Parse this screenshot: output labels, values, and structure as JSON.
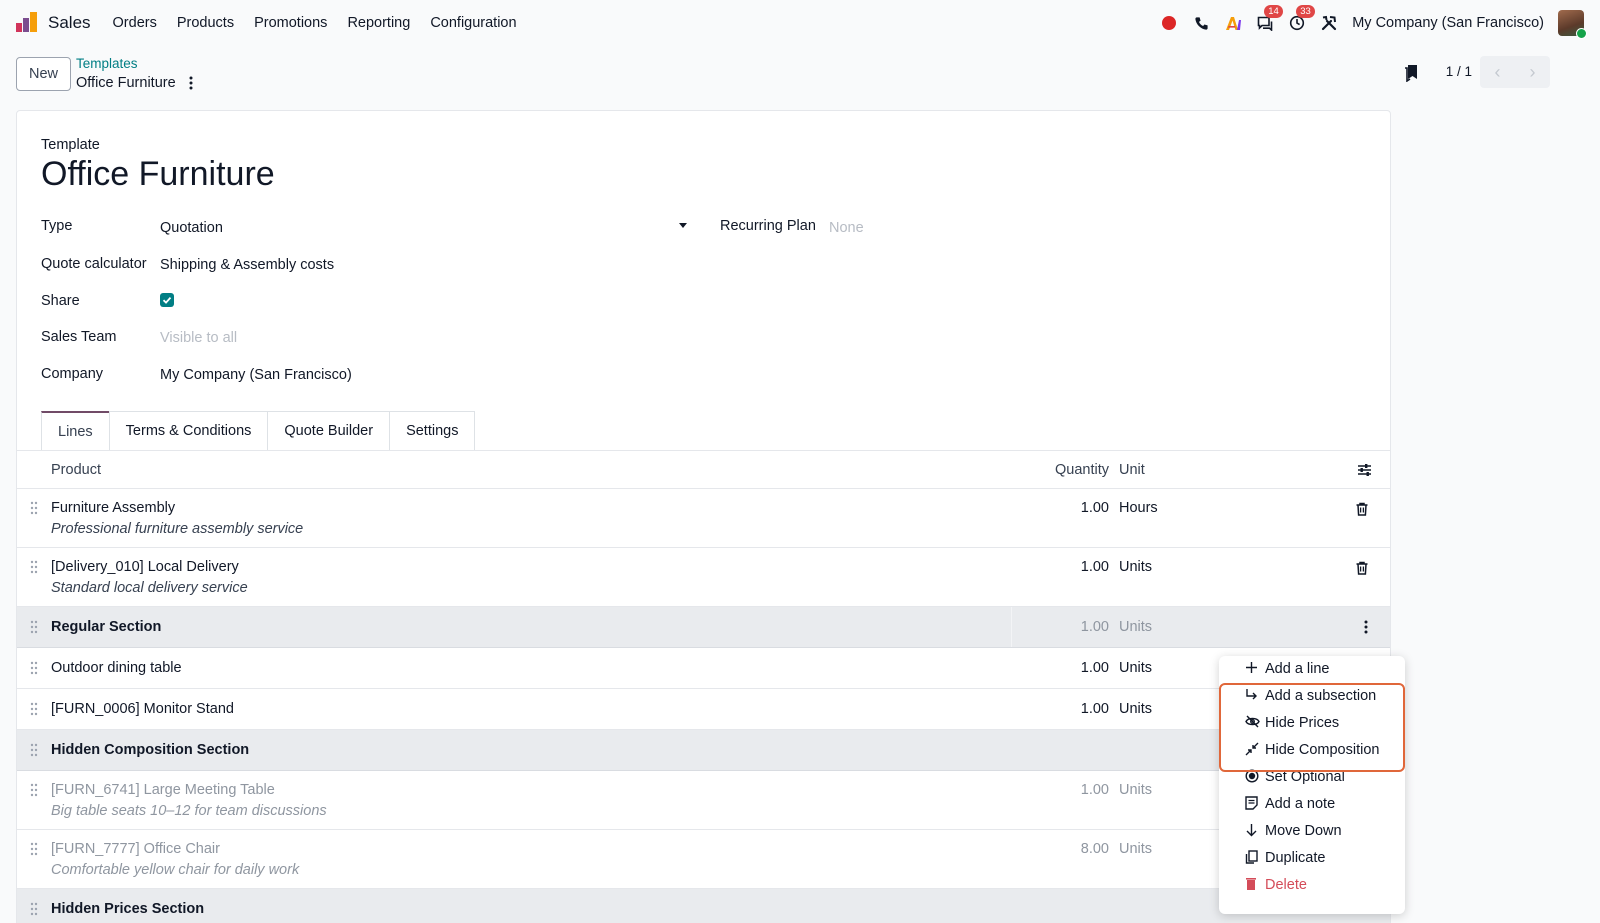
{
  "navbar": {
    "app_name": "Sales",
    "menu": [
      "Orders",
      "Products",
      "Promotions",
      "Reporting",
      "Configuration"
    ],
    "messages_badge": "14",
    "activities_badge": "33",
    "company": "My Company (San Francisco)"
  },
  "control": {
    "new_label": "New",
    "breadcrumb_parent": "Templates",
    "breadcrumb_current": "Office Furniture",
    "pager": "1 / 1"
  },
  "form": {
    "label_template": "Template",
    "title": "Office Furniture",
    "type_label": "Type",
    "type_value": "Quotation",
    "recurring_label": "Recurring Plan",
    "recurring_placeholder": "None",
    "quote_calc_label": "Quote calculator",
    "quote_calc_value": "Shipping & Assembly costs",
    "share_label": "Share",
    "share_checked": true,
    "sales_team_label": "Sales Team",
    "sales_team_placeholder": "Visible to all",
    "company_label": "Company",
    "company_value": "My Company (San Francisco)"
  },
  "tabs": [
    "Lines",
    "Terms & Conditions",
    "Quote Builder",
    "Settings"
  ],
  "list": {
    "headers": {
      "product": "Product",
      "quantity": "Quantity",
      "unit": "Unit"
    },
    "rows": [
      {
        "kind": "line",
        "name": "Furniture Assembly",
        "desc": "Professional furniture assembly service",
        "qty": "1.00",
        "unit": "Hours"
      },
      {
        "kind": "line",
        "name": "[Delivery_010] Local Delivery",
        "desc": "Standard local delivery service",
        "qty": "1.00",
        "unit": "Units"
      },
      {
        "kind": "section",
        "name": "Regular Section",
        "qty": "1.00",
        "unit": "Units"
      },
      {
        "kind": "line",
        "name": "Outdoor dining table",
        "qty": "1.00",
        "unit": "Units"
      },
      {
        "kind": "line",
        "name": "[FURN_0006] Monitor Stand",
        "qty": "1.00",
        "unit": "Units"
      },
      {
        "kind": "section",
        "name": "Hidden Composition Section"
      },
      {
        "kind": "line",
        "name": "[FURN_6741] Large Meeting Table",
        "desc": "Big table seats 10–12 for team discussions",
        "qty": "1.00",
        "unit": "Units"
      },
      {
        "kind": "line",
        "name": "[FURN_7777] Office Chair",
        "desc": "Comfortable yellow chair for daily work",
        "qty": "8.00",
        "unit": "Units"
      },
      {
        "kind": "section",
        "name": "Hidden Prices Section"
      }
    ]
  },
  "dropdown": {
    "items": [
      "Add a line",
      "Add a subsection",
      "Hide Prices",
      "Hide Composition",
      "Set Optional",
      "Add a note",
      "Move Down",
      "Duplicate",
      "Delete"
    ],
    "highlight_color": "#e0673a"
  },
  "colors": {
    "primary": "#017e84",
    "accent": "#714b67",
    "danger": "#d44c59"
  }
}
